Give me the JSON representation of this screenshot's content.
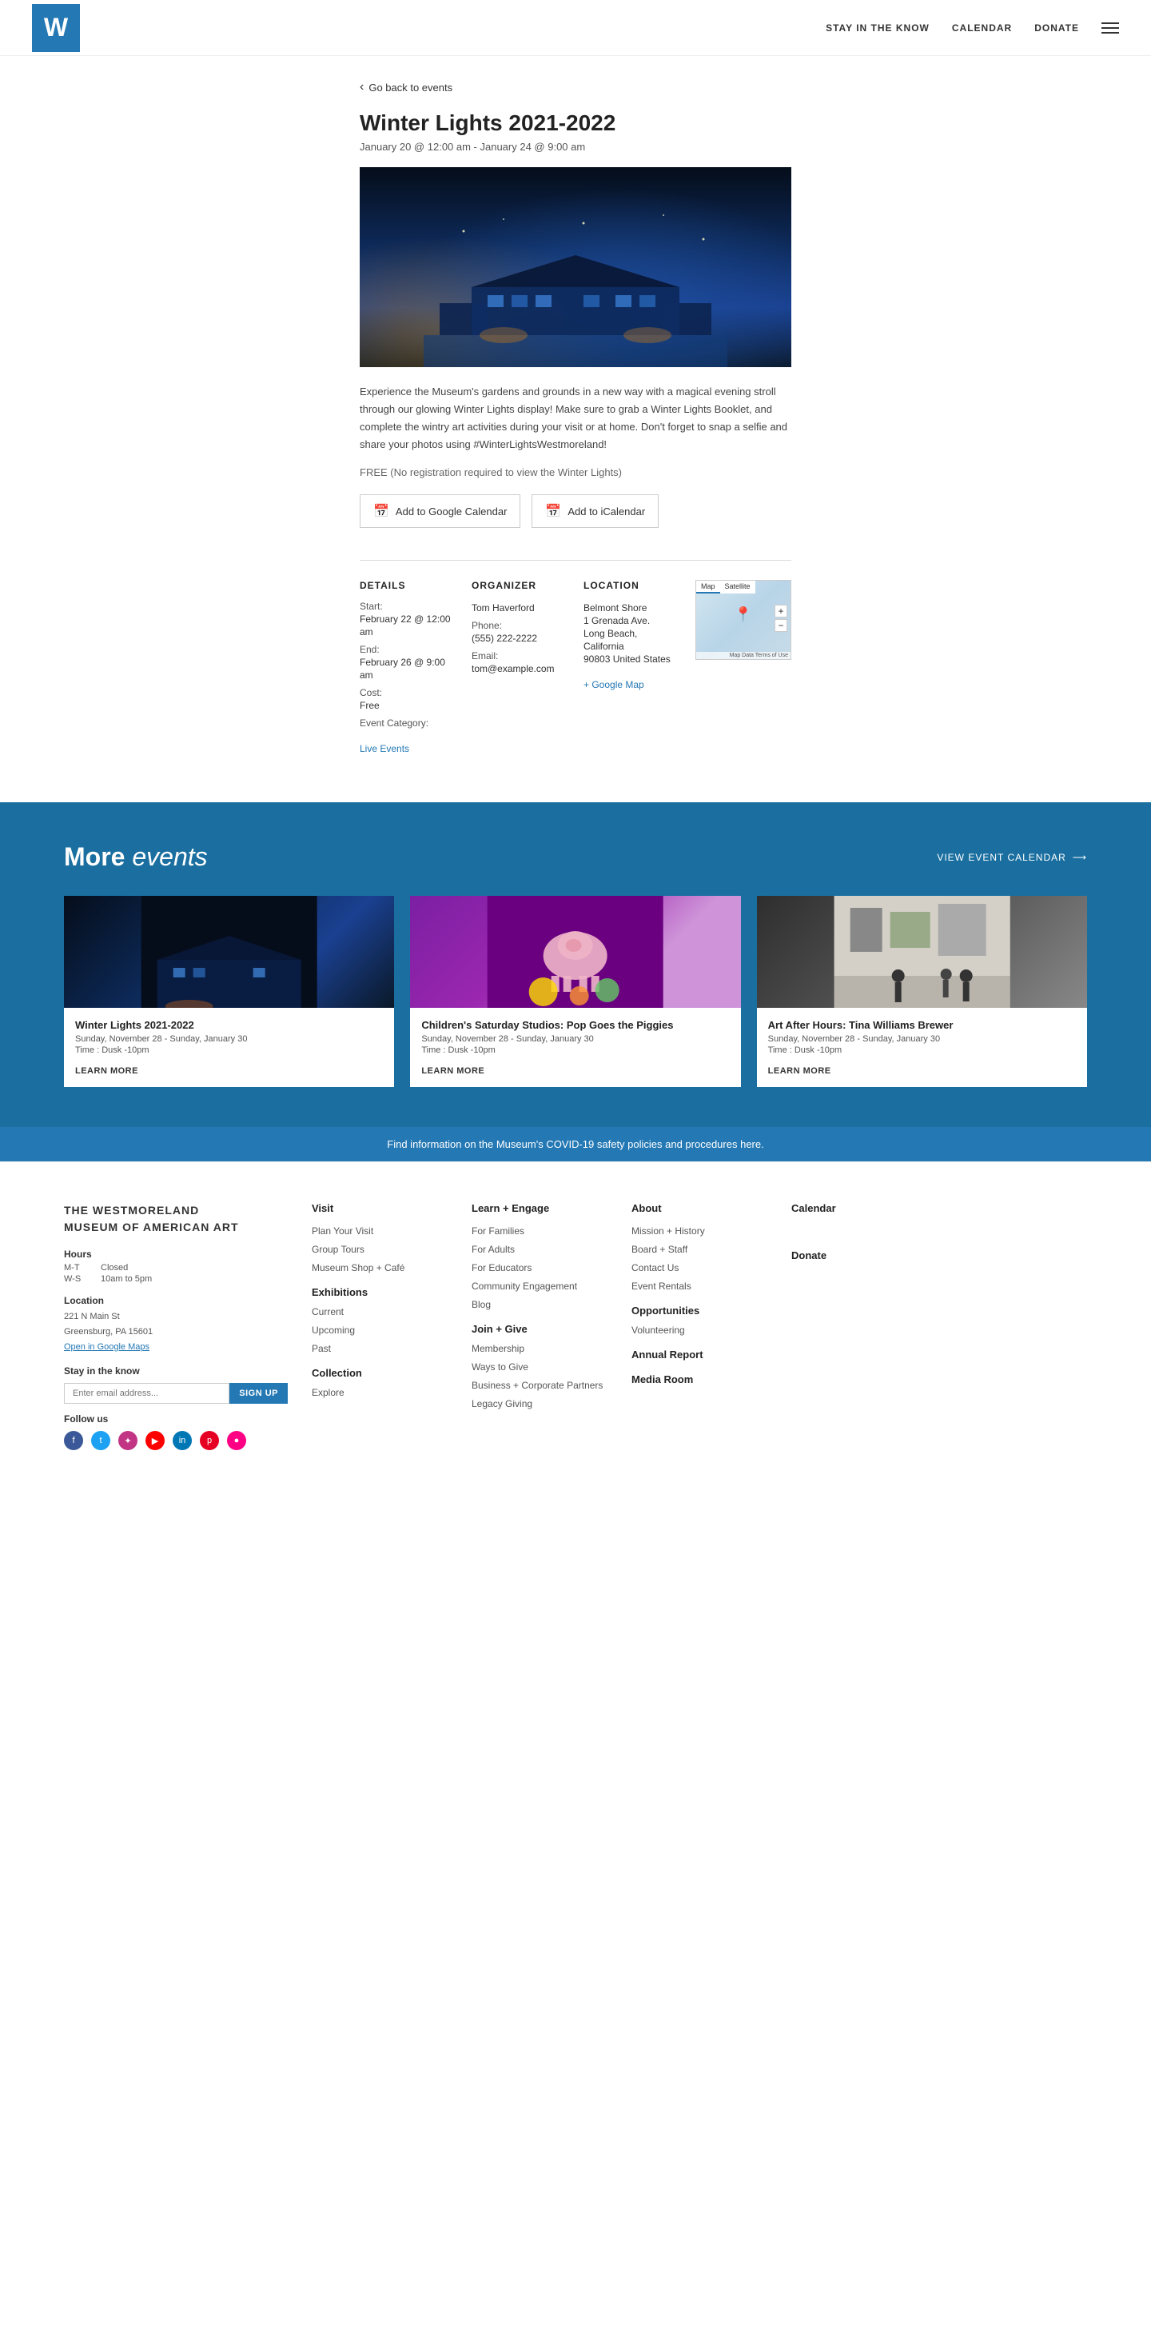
{
  "header": {
    "logo": "W",
    "nav_items": [
      {
        "label": "STAY IN THE KNOW",
        "href": "#"
      },
      {
        "label": "CALENDAR",
        "href": "#"
      },
      {
        "label": "DONATE",
        "href": "#"
      }
    ]
  },
  "breadcrumb": {
    "label": "Go back to events",
    "href": "#"
  },
  "event": {
    "title": "Winter Lights 2021-2022",
    "date_range": "January 20 @ 12:00 am - January 24 @ 9:00 am",
    "description": "Experience the Museum's gardens and grounds in a new way with a magical evening stroll through our glowing Winter Lights display! Make sure to grab a Winter Lights Booklet, and complete the wintry art activities during your visit or at home. Don't forget to snap a selfie and share your photos using #WinterLightsWestmoreland!",
    "cost_note": "FREE (No registration required to view the Winter Lights)",
    "add_google_calendar": "Add to Google Calendar",
    "add_icalendar": "Add to iCalendar"
  },
  "details": {
    "title": "DETAILS",
    "start_label": "Start:",
    "start_value": "February 22 @ 12:00 am",
    "end_label": "End:",
    "end_value": "February 26 @ 9:00 am",
    "cost_label": "Cost:",
    "cost_value": "Free",
    "category_label": "Event Category:",
    "category_value": "Live Events"
  },
  "organizer": {
    "title": "ORGANIZER",
    "name": "Tom Haverford",
    "phone_label": "Phone:",
    "phone_value": "(555) 222-2222",
    "email_label": "Email:",
    "email_value": "tom@example.com"
  },
  "location": {
    "title": "LOCATION",
    "name": "Belmont Shore",
    "address": "1 Grenada Ave.",
    "city": "Long Beach, California",
    "zip_country": "90803 United States",
    "google_map_link": "+ Google Map"
  },
  "map": {
    "tab_map": "Map",
    "tab_satellite": "Satellite",
    "credit": "Map Data  Terms of Use"
  },
  "more_events": {
    "title_plain": "More",
    "title_italic": "events",
    "view_calendar_label": "VIEW EVENT CALENDAR",
    "events": [
      {
        "title": "Winter Lights 2021-2022",
        "date": "Sunday, November 28 - Sunday, January 30",
        "time": "Time : Dusk -10pm",
        "learn_more": "LEARN MORE",
        "image_type": "blue-night"
      },
      {
        "title": "Children's Saturday Studios: Pop Goes the Piggies",
        "date": "Sunday, November 28 - Sunday, January 30",
        "time": "Time : Dusk -10pm",
        "learn_more": "LEARN MORE",
        "image_type": "pink-pig"
      },
      {
        "title": "Art After Hours: Tina Williams Brewer",
        "date": "Sunday, November 28 - Sunday, January 30",
        "time": "Time : Dusk -10pm",
        "learn_more": "LEARN MORE",
        "image_type": "gallery"
      }
    ]
  },
  "covid_banner": {
    "text": "Find information on the Museum's COVID-19 safety policies and procedures here."
  },
  "footer": {
    "brand_name_line1": "THE WESTMORELAND",
    "brand_name_line2": "MUSEUM of AMERICAN ART",
    "hours_label": "Hours",
    "hours": [
      {
        "days": "M-T",
        "time": "Closed"
      },
      {
        "days": "W-S",
        "time": "10am to 5pm"
      }
    ],
    "location_label": "Location",
    "address_line1": "221 N Main St",
    "address_line2": "Greensburg, PA 15601",
    "address_map_link": "Open in Google Maps",
    "stay_label": "Stay in the know",
    "email_placeholder": "Enter email address...",
    "signup_button": "SIGN UP",
    "follow_label": "Follow us",
    "social": [
      "f",
      "t",
      "i",
      "y",
      "in",
      "p",
      "●●"
    ],
    "footer_cols": [
      {
        "col_id": "visit",
        "heading": "Visit",
        "items": [
          "Plan Your Visit",
          "Group Tours",
          "Museum Shop + Café"
        ],
        "sections": [
          {
            "heading": "Exhibitions",
            "items": [
              "Current",
              "Upcoming",
              "Past"
            ]
          },
          {
            "heading": "Collection",
            "items": [
              "Explore"
            ]
          }
        ]
      },
      {
        "col_id": "learn",
        "heading": "Learn + Engage",
        "items": [
          "For Families",
          "For Adults",
          "For Educators",
          "Community Engagement",
          "Blog"
        ],
        "sections": [
          {
            "heading": "Join + Give",
            "items": [
              "Membership",
              "Ways to Give",
              "Business + Corporate Partners",
              "Legacy Giving"
            ]
          }
        ]
      },
      {
        "col_id": "about",
        "heading": "About",
        "items": [
          "Mission + History",
          "Board + Staff",
          "Contact Us",
          "Event Rentals"
        ],
        "sections": [
          {
            "heading": "Opportunities",
            "items": [
              "Volunteering"
            ]
          },
          {
            "heading": "Annual Report",
            "items": []
          },
          {
            "heading": "Media Room",
            "items": []
          }
        ]
      },
      {
        "col_id": "calendar-donate",
        "heading": "Calendar",
        "items": [],
        "sections": [
          {
            "heading": "Donate",
            "items": []
          }
        ]
      }
    ]
  }
}
